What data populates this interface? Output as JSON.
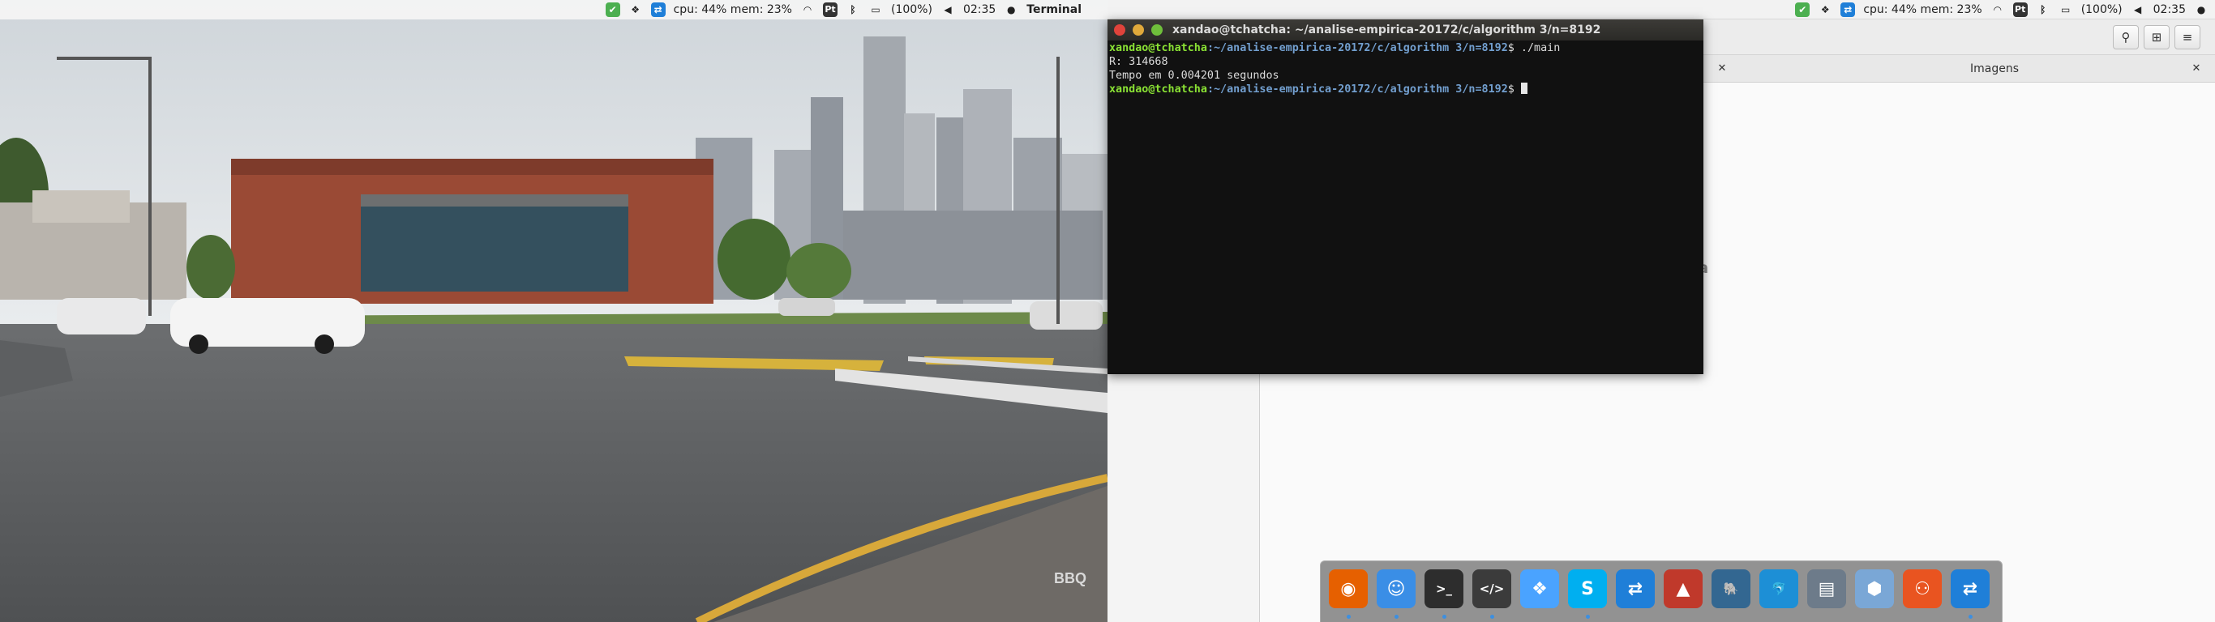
{
  "left_panel": {
    "cpu_mem": "cpu: 44% mem: 23%",
    "keyboard": "Pt",
    "battery": "(100%)",
    "clock": "02:35",
    "app_name": "Terminal"
  },
  "right_panel": {
    "cpu_mem": "cpu: 44% mem: 23%",
    "keyboard": "Pt",
    "battery": "(100%)",
    "clock": "02:35"
  },
  "wallpaper": {
    "watermark": "BBQ"
  },
  "terminal": {
    "title": "xandao@tchatcha: ~/analise-empirica-20172/c/algorithm 3/n=8192",
    "lines": [
      {
        "user": "xandao@tchatcha",
        "path": ":~/analise-empirica-20172/c/algorithm 3/n=8192",
        "cmd": "$ ./main"
      },
      {
        "text": "R: 314668"
      },
      {
        "text": "Tempo em 0.004201 segundos"
      },
      {
        "user": "xandao@tchatcha",
        "path": ":~/analise-empirica-20172/c/algorithm 3/n=8192",
        "cmd": "$ "
      }
    ]
  },
  "file_manager": {
    "tab_images_label": "Imagens",
    "empty_message": "Pasta está vazia"
  },
  "dock": {
    "items": [
      {
        "icon": "firefox-icon",
        "color": "#e66000",
        "glyph": "◉"
      },
      {
        "icon": "finder-icon",
        "color": "#3a8ee6",
        "glyph": "☺"
      },
      {
        "icon": "terminal-icon",
        "color": "#2d2d2d",
        "glyph": ">_"
      },
      {
        "icon": "code-editor-icon",
        "color": "#3b3b3b",
        "glyph": "</>"
      },
      {
        "icon": "dropbox-icon",
        "color": "#4aa3ff",
        "glyph": "❖"
      },
      {
        "icon": "skype-icon",
        "color": "#00aff0",
        "glyph": "S"
      },
      {
        "icon": "teamviewer-icon",
        "color": "#1f7fd8",
        "glyph": "⇄"
      },
      {
        "icon": "matlab-icon",
        "color": "#c0392b",
        "glyph": "▲"
      },
      {
        "icon": "postgresql-icon",
        "color": "#336791",
        "glyph": "🐘"
      },
      {
        "icon": "mysql-workbench-icon",
        "color": "#1d8fd6",
        "glyph": "🐬"
      },
      {
        "icon": "scanner-icon",
        "color": "#6d7b8a",
        "glyph": "▤"
      },
      {
        "icon": "virtualbox-icon",
        "color": "#7aa7d6",
        "glyph": "⬢"
      },
      {
        "icon": "ubuntu-software-icon",
        "color": "#e95420",
        "glyph": "⚇"
      },
      {
        "icon": "teamviewer-icon",
        "color": "#1f7fd8",
        "glyph": "⇄"
      }
    ]
  }
}
